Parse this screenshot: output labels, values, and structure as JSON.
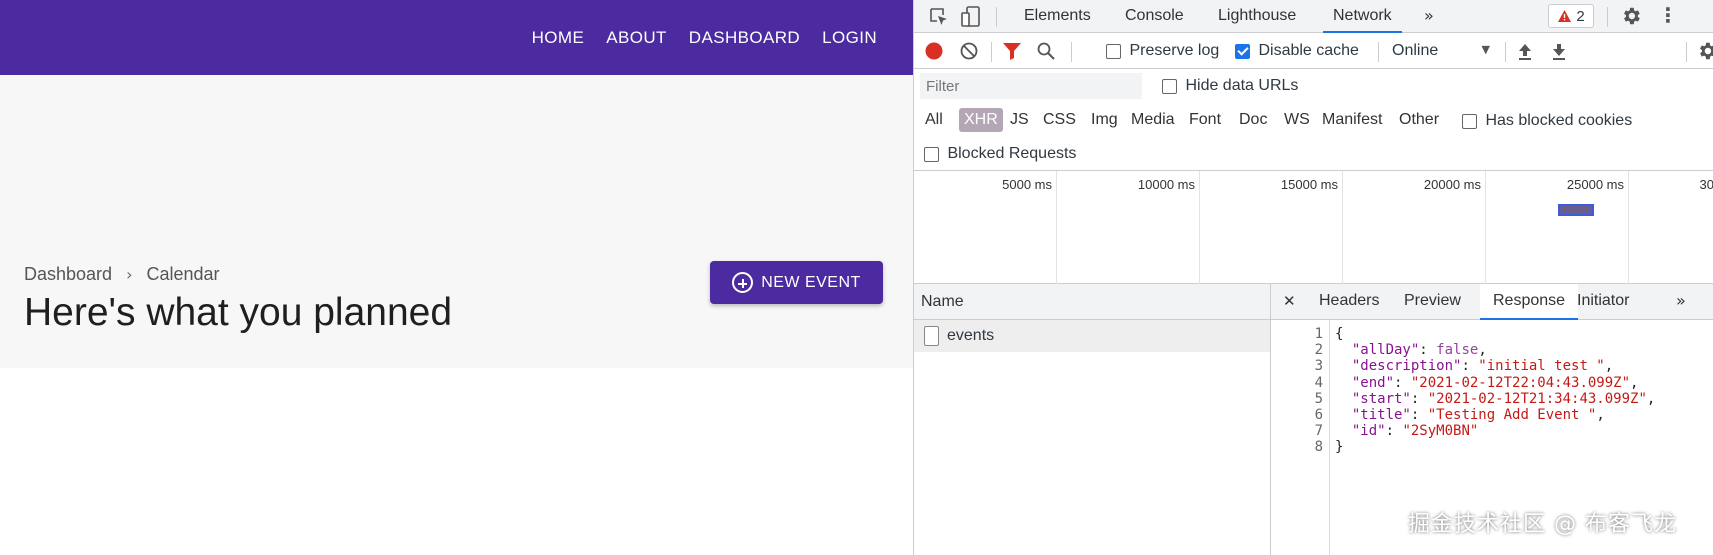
{
  "app": {
    "nav": [
      "HOME",
      "ABOUT",
      "DASHBOARD",
      "LOGIN"
    ],
    "breadcrumb": [
      "Dashboard",
      "Calendar"
    ],
    "title": "Here's what you planned",
    "new_event_label": "NEW EVENT",
    "brand_color": "#4c2a9f"
  },
  "devtools": {
    "tabs": [
      "Elements",
      "Console",
      "Lighthouse",
      "Network"
    ],
    "active_tab": "Network",
    "warning_count": "2",
    "toolbar": {
      "preserve_log": "Preserve log",
      "disable_cache": "Disable cache",
      "throttle": "Online"
    },
    "filter": {
      "placeholder": "Filter",
      "hide_data_urls": "Hide data URLs"
    },
    "types": [
      "All",
      "XHR",
      "JS",
      "CSS",
      "Img",
      "Media",
      "Font",
      "Doc",
      "WS",
      "Manifest",
      "Other"
    ],
    "active_type": "XHR",
    "has_blocked_cookies": "Has blocked cookies",
    "blocked_requests": "Blocked Requests",
    "timeline_labels": [
      "5000 ms",
      "10000 ms",
      "15000 ms",
      "20000 ms",
      "25000 ms",
      "30"
    ],
    "name_header": "Name",
    "request": "events",
    "detail_tabs": [
      "Headers",
      "Preview",
      "Response",
      "Initiator"
    ],
    "active_detail_tab": "Response",
    "response": [
      {
        "n": "1",
        "key": "",
        "val": "",
        "text": "{"
      },
      {
        "n": "2",
        "key": "\"allDay\"",
        "val": "false",
        "type": "b"
      },
      {
        "n": "3",
        "key": "\"description\"",
        "val": "\"initial test \"",
        "type": "s"
      },
      {
        "n": "4",
        "key": "\"end\"",
        "val": "\"2021-02-12T22:04:43.099Z\"",
        "type": "s"
      },
      {
        "n": "5",
        "key": "\"start\"",
        "val": "\"2021-02-12T21:34:43.099Z\"",
        "type": "s"
      },
      {
        "n": "6",
        "key": "\"title\"",
        "val": "\"Testing Add Event \"",
        "type": "s"
      },
      {
        "n": "7",
        "key": "\"id\"",
        "val": "\"2SyM0BN\"",
        "type": "s",
        "last": true
      },
      {
        "n": "8",
        "key": "",
        "val": "",
        "text": "}"
      }
    ]
  },
  "watermark": "掘金技术社区 @ 布客飞龙"
}
